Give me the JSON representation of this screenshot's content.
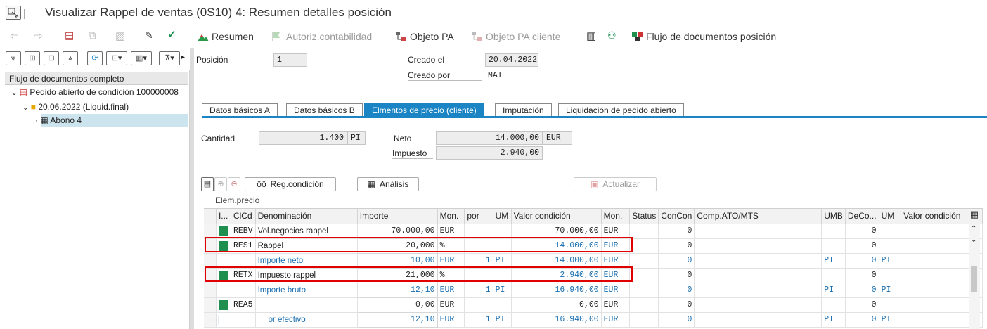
{
  "window": {
    "title": "Visualizar Rappel de ventas (0S10) 4: Resumen detalles posición"
  },
  "toolbar": {
    "resumen": "Resumen",
    "autoriz": "Autoriz.contabilidad",
    "objeto_pa": "Objeto PA",
    "objeto_pa_cliente": "Objeto PA cliente",
    "flujo": "Flujo de documentos posición"
  },
  "tree": {
    "header": "Flujo de documentos completo",
    "root": "Pedido abierto de condición 100000008",
    "child": "20.06.2022 (Liquid.final)",
    "leaf": "Abono 4"
  },
  "form": {
    "posicion_label": "Posición",
    "posicion": "1",
    "creado_el_label": "Creado el",
    "creado_el": "20.04.2022",
    "creado_por_label": "Creado por",
    "creado_por": "MAI"
  },
  "tabs": [
    "Datos básicos A",
    "Datos básicos B",
    "Elmentos de precio (cliente)",
    "Imputación",
    "Liquidación de pedido abierto"
  ],
  "summary": {
    "cantidad_label": "Cantidad",
    "cantidad": "1.400",
    "cantidad_unit": "PI",
    "neto_label": "Neto",
    "neto": "14.000,00",
    "neto_currency": "EUR",
    "impuesto_label": "Impuesto",
    "impuesto": "2.940,00"
  },
  "buttons": {
    "reg": "Reg.condición",
    "analisis": "Análisis",
    "actualizar": "Actualizar"
  },
  "grid": {
    "title": "Elem.precio",
    "columns": [
      "I...",
      "ClCd",
      "Denominación",
      "Importe",
      "Mon.",
      "por",
      "UM",
      "Valor condición",
      "Mon.",
      "Status",
      "ConCon",
      "Comp.ATO/MTS",
      "UMB",
      "DeCo...",
      "UM",
      "Valor condición"
    ],
    "rows": [
      {
        "sq": true,
        "clcd": "REBV",
        "den": "Vol.negocios rappel",
        "imp": "70.000,00",
        "mon": "EUR",
        "por": "",
        "um": "",
        "val": "70.000,00",
        "mon2": "EUR",
        "concon": "0",
        "umb": "",
        "deco": "0",
        "um2": "",
        "blue": false
      },
      {
        "sq": true,
        "clcd": "RES1",
        "den": "Rappel",
        "imp": "20,000",
        "mon": "%",
        "por": "",
        "um": "",
        "val": "14.000,00",
        "mon2": "EUR",
        "concon": "0",
        "umb": "",
        "deco": "0",
        "um2": "",
        "blue": false,
        "valblue": true
      },
      {
        "sq": false,
        "clcd": "",
        "den": "Importe neto",
        "imp": "10,00",
        "mon": "EUR",
        "por": "1",
        "um": "PI",
        "val": "14.000,00",
        "mon2": "EUR",
        "concon": "0",
        "umb": "PI",
        "deco": "0",
        "um2": "PI",
        "blue": true
      },
      {
        "sq": true,
        "clcd": "RETX",
        "den": "Impuesto rappel",
        "imp": "21,000",
        "mon": "%",
        "por": "",
        "um": "",
        "val": "2.940,00",
        "mon2": "EUR",
        "concon": "0",
        "umb": "",
        "deco": "0",
        "um2": "",
        "blue": false,
        "valblue": true
      },
      {
        "sq": false,
        "clcd": "",
        "den": "Importe bruto",
        "imp": "12,10",
        "mon": "EUR",
        "por": "1",
        "um": "PI",
        "val": "16.940,00",
        "mon2": "EUR",
        "concon": "0",
        "umb": "PI",
        "deco": "0",
        "um2": "PI",
        "blue": true
      },
      {
        "sq": true,
        "clcd": "REA5",
        "den": "",
        "imp": "0,00",
        "mon": "EUR",
        "por": "",
        "um": "",
        "val": "0,00",
        "mon2": "EUR",
        "concon": "0",
        "umb": "",
        "deco": "0",
        "um2": "",
        "blue": false
      },
      {
        "sq": false,
        "clcd": "",
        "den": "or efectivo",
        "imp": "12,10",
        "mon": "EUR",
        "por": "1",
        "um": "PI",
        "val": "16.940,00",
        "mon2": "EUR",
        "concon": "0",
        "umb": "PI",
        "deco": "0",
        "um2": "PI",
        "blue": true,
        "cursor": true
      }
    ]
  },
  "colors": {
    "accent": "#1b84c5",
    "highlight_box": "#e00000",
    "status_square": "#1e8f4e",
    "blue_text": "#1a6fb0"
  }
}
